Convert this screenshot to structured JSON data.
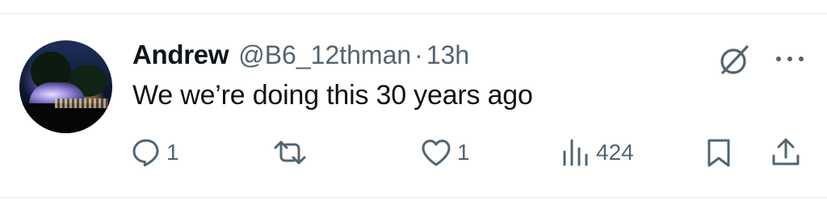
{
  "tweet": {
    "author_name": "Andrew",
    "handle": "@B6_12thman",
    "separator": "·",
    "time": "13h",
    "text": "We we’re doing this 30 years ago"
  },
  "actions": {
    "reply_count": "1",
    "like_count": "1",
    "view_count": "424"
  },
  "icons": [
    "avatar",
    "grok-icon",
    "more-icon",
    "reply-icon",
    "retweet-icon",
    "like-icon",
    "views-icon",
    "bookmark-icon",
    "share-icon"
  ],
  "colors": {
    "text": "#0f1419",
    "secondary": "#536471",
    "divider": "#e6e9eb"
  }
}
